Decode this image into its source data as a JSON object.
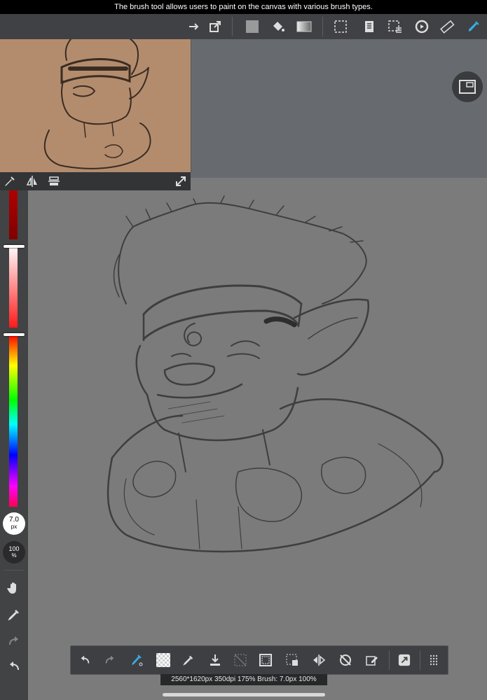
{
  "tooltip": {
    "text": "The brush tool allows users to paint on the canvas with various brush types."
  },
  "top_toolbar": {
    "icons": [
      "transform-icon",
      "export-icon",
      "fill-color-icon",
      "bucket-icon",
      "gradient-icon",
      "select-icon",
      "layers-icon",
      "select-menu-icon",
      "rotate-icon",
      "ruler-icon",
      "brush-icon"
    ]
  },
  "left_panel": {
    "brush_size": {
      "value": "7.0",
      "unit": "px"
    },
    "opacity": {
      "value": "100",
      "unit": "%"
    },
    "hue_handle_fraction": 0.45,
    "brightness_handle_fraction": 0.0
  },
  "status_bar": {
    "text": "2560*1620px 350dpi 175% Brush: 7.0px 100%"
  },
  "colors": {
    "accent": "#3aa9e0",
    "toolbar": "#3f4144",
    "canvas": "#7b7b7b",
    "navigator_bg": "#b38c6e"
  }
}
